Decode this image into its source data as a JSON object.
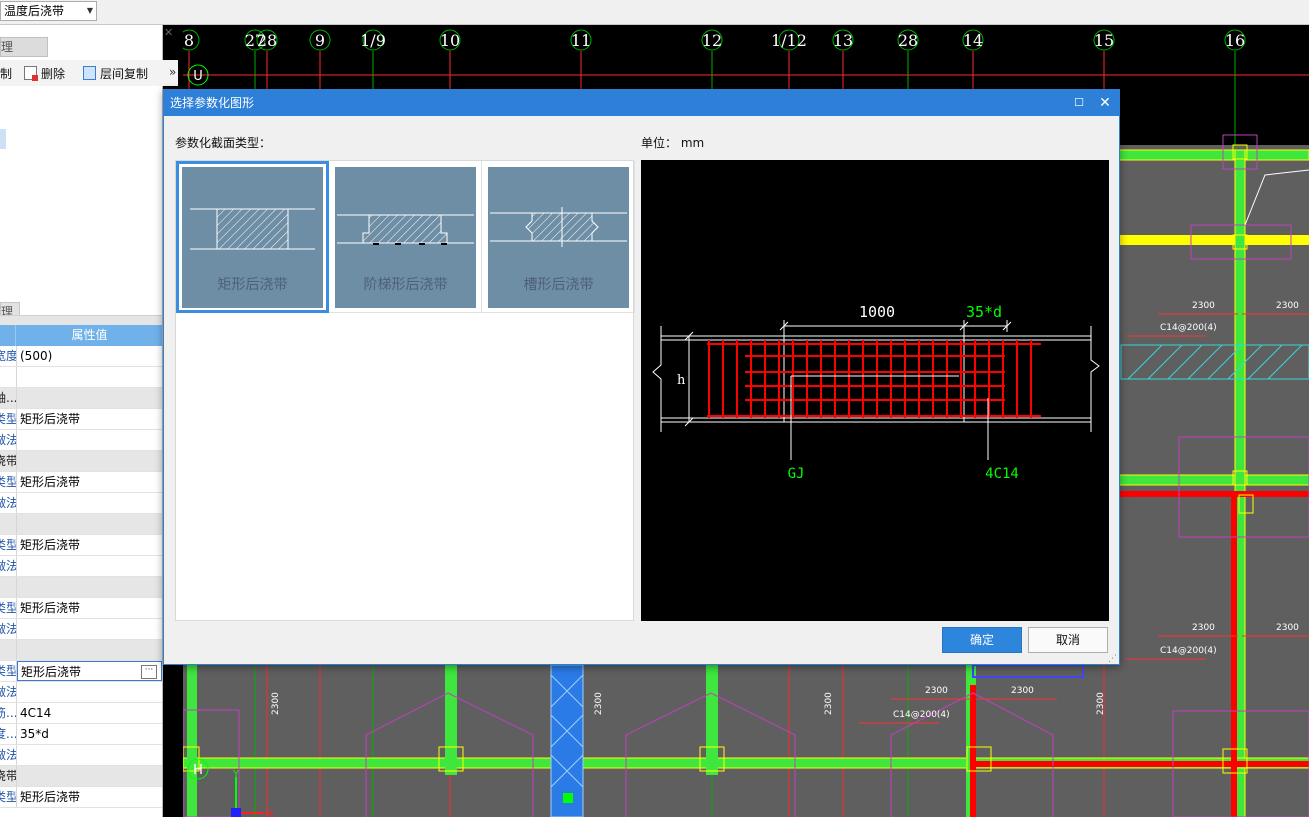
{
  "toolbar": {
    "layer_select_value": "温度后浇带"
  },
  "left_panel": {
    "top_tab_label": "管理",
    "actions": [
      {
        "label": "复制",
        "icon": "copy-icon"
      },
      {
        "label": "删除",
        "icon": "delete-icon"
      },
      {
        "label": "层间复制",
        "icon": "floor-copy-icon"
      }
    ],
    "more_label": "»",
    "props_tab_label": "管理",
    "props_header": "属性值",
    "props": [
      {
        "name": "宽度",
        "value": "(500)",
        "group": false
      },
      {
        "name": "",
        "value": "",
        "group": false
      },
      {
        "name": "轴...",
        "value": "",
        "group": true
      },
      {
        "name": "类型",
        "value": "矩形后浇带",
        "group": false
      },
      {
        "name": "做法",
        "value": "",
        "group": false
      },
      {
        "name": "浇带",
        "value": "",
        "group": true
      },
      {
        "name": "类型",
        "value": "矩形后浇带",
        "group": false
      },
      {
        "name": "做法",
        "value": "",
        "group": false
      },
      {
        "name": "",
        "value": "",
        "group": true
      },
      {
        "name": "类型",
        "value": "矩形后浇带",
        "group": false
      },
      {
        "name": "做法",
        "value": "",
        "group": false
      },
      {
        "name": "",
        "value": "",
        "group": true
      },
      {
        "name": "类型",
        "value": "矩形后浇带",
        "group": false
      },
      {
        "name": "做法",
        "value": "",
        "group": false
      },
      {
        "name": "",
        "value": "",
        "group": true
      },
      {
        "name": "类型",
        "value": "矩形后浇带",
        "group": false,
        "editing": true
      },
      {
        "name": "做法",
        "value": "",
        "group": false
      },
      {
        "name": "筋...",
        "value": "4C14",
        "group": false
      },
      {
        "name": "度...",
        "value": "35*d",
        "group": false
      },
      {
        "name": "做法",
        "value": "",
        "group": false
      },
      {
        "name": "浇带",
        "value": "",
        "group": true
      },
      {
        "name": "类型",
        "value": "矩形后浇带",
        "group": false
      }
    ]
  },
  "cad": {
    "axis_labels": [
      "8",
      "27",
      "28",
      "9",
      "1/9",
      "10",
      "11",
      "12",
      "1/12",
      "13",
      "28",
      "14",
      "15",
      "16"
    ],
    "row_labels": [
      "U",
      "H"
    ],
    "dims": [
      "2300",
      "2300",
      "C14@200(4)",
      "2300",
      "2300",
      "C14@200(4)",
      "2300",
      "2300",
      "C14@200(4)",
      "2300",
      "2300",
      "2300",
      "2300"
    ],
    "ucs": {
      "x": "X",
      "y": "Y"
    }
  },
  "dialog": {
    "title": "选择参数化图形",
    "section_label": "参数化截面类型：",
    "unit_label": "单位：  mm",
    "shapes": [
      {
        "label": "矩形后浇带",
        "selected": true
      },
      {
        "label": "阶梯形后浇带",
        "selected": false
      },
      {
        "label": "槽形后浇带",
        "selected": false
      }
    ],
    "preview": {
      "dim_length": "1000",
      "dim_lap": "35*d",
      "height_label": "h",
      "rebar_gj": "GJ",
      "rebar_main": "4C14"
    },
    "ok_label": "确定",
    "cancel_label": "取消"
  },
  "colors": {
    "dialog_title": "#2e7fd8",
    "cad_bg": "#5f5f5f",
    "beam_green": "#3ee63e",
    "rebar_red": "#ff0000",
    "hatch_cyan": "#39d7d7",
    "magenta": "#c040c0",
    "axis_green": "#00ff00"
  }
}
